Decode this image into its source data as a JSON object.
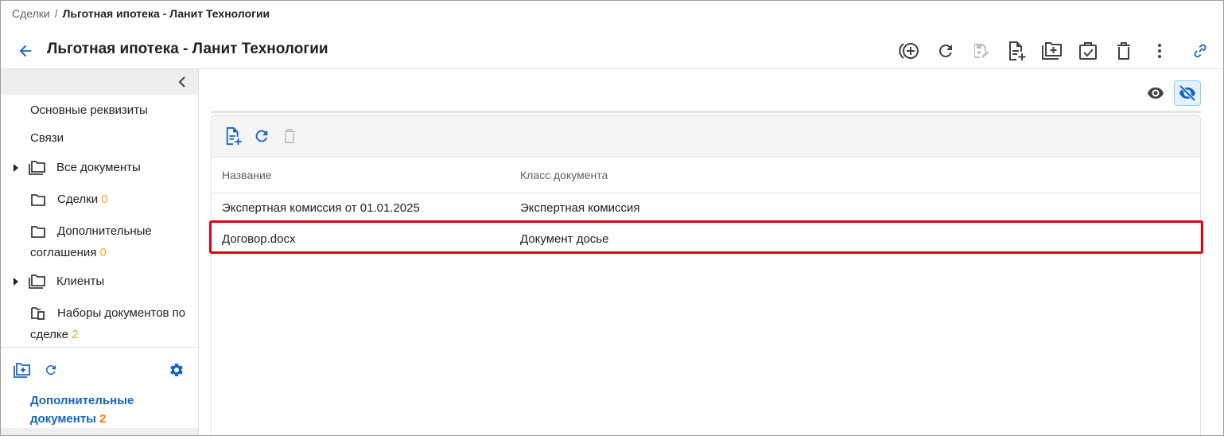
{
  "breadcrumb": {
    "parent": "Сделки",
    "separator": "/",
    "current": "Льготная ипотека - Ланит Технологии"
  },
  "page_title": "Льготная ипотека - Ланит Технологии",
  "header_toolbar": [
    "add-circle-icon",
    "refresh-icon",
    "save-edit-icon",
    "add-document-icon",
    "add-folder-icon",
    "task-check-icon",
    "delete-icon",
    "more-vert-icon",
    "link-icon"
  ],
  "sidebar": {
    "items": [
      {
        "label": "Основные реквизиты"
      },
      {
        "label": "Связи"
      },
      {
        "label": "Все документы",
        "icon": "folders-icon"
      },
      {
        "label": "Сделки",
        "count": "0",
        "icon": "folder-icon"
      },
      {
        "label_line1": "Дополнительные",
        "label_line2": "соглашения",
        "count": "0",
        "icon": "folder-icon"
      },
      {
        "label": "Клиенты",
        "icon": "folders-icon"
      },
      {
        "label_line1": "Наборы документов по",
        "label_line2": "сделке",
        "count": "2",
        "icon": "doc-set-icon"
      }
    ],
    "extra": {
      "label_line1": "Дополнительные",
      "label_line2": "документы",
      "count": "2"
    }
  },
  "table": {
    "columns": [
      "Название",
      "Класс документа"
    ],
    "rows": [
      {
        "name": "Экспертная комиссия от 01.01.2025",
        "class": "Экспертная комиссия"
      },
      {
        "name": "Договор.docx",
        "class": "Документ досье"
      }
    ]
  },
  "colors": {
    "accent": "#1565c0",
    "count": "#f5a623",
    "highlight": "#e0000f"
  }
}
